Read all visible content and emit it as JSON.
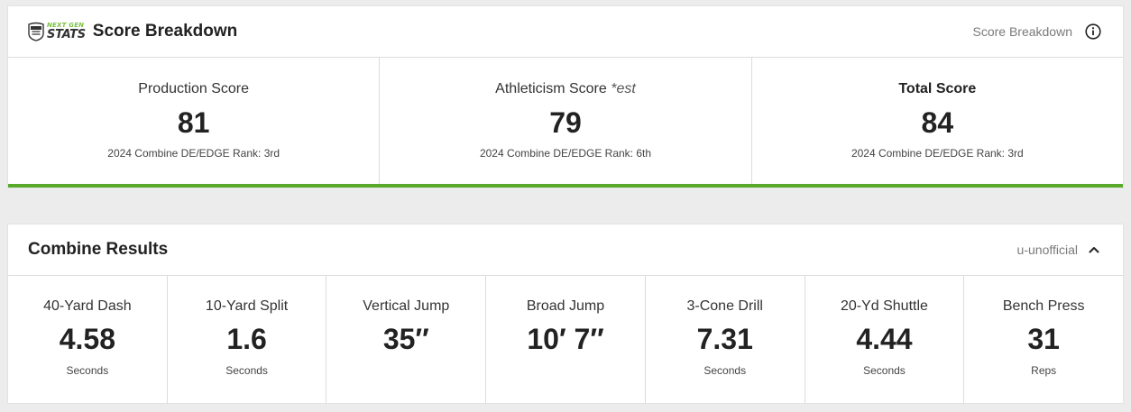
{
  "score_card": {
    "logo": {
      "top_text": "NEXT GEN",
      "bottom_text": "STATS",
      "shield_icon": "nfl-shield-icon"
    },
    "title": "Score Breakdown",
    "right_label": "Score Breakdown",
    "info_icon": "info-icon",
    "scores": [
      {
        "label": "Production Score",
        "est": "",
        "value": "81",
        "rank": "2024 Combine DE/EDGE Rank: 3rd"
      },
      {
        "label": "Athleticism Score",
        "est": "*est",
        "value": "79",
        "rank": "2024 Combine DE/EDGE Rank: 6th"
      },
      {
        "label": "Total Score",
        "est": "",
        "value": "84",
        "rank": "2024 Combine DE/EDGE Rank: 3rd"
      }
    ],
    "accent_color": "#59a92c"
  },
  "combine_card": {
    "title": "Combine Results",
    "right_label": "u-unofficial",
    "chevron_icon": "chevron-up-icon",
    "results": [
      {
        "label": "40-Yard Dash",
        "value": "4.58",
        "unit": "Seconds"
      },
      {
        "label": "10-Yard Split",
        "value": "1.6",
        "unit": "Seconds"
      },
      {
        "label": "Vertical Jump",
        "value": "35″",
        "unit": ""
      },
      {
        "label": "Broad Jump",
        "value": "10′ 7″",
        "unit": ""
      },
      {
        "label": "3-Cone Drill",
        "value": "7.31",
        "unit": "Seconds"
      },
      {
        "label": "20-Yd Shuttle",
        "value": "4.44",
        "unit": "Seconds"
      },
      {
        "label": "Bench Press",
        "value": "31",
        "unit": "Reps"
      }
    ]
  }
}
